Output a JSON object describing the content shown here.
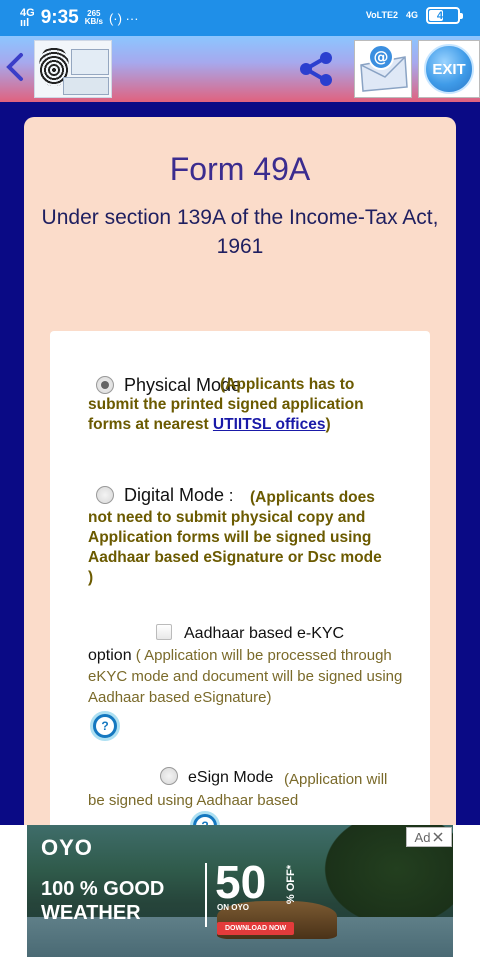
{
  "status_bar": {
    "network": "4G",
    "time": "9:35",
    "speed_value": "265",
    "speed_unit": "KB/s",
    "misc_icons": "(·) ···",
    "volte": "VoLTE2",
    "net_right": "4G",
    "battery": "44"
  },
  "app_bar": {
    "back_icon": "chevron-left-icon",
    "share_icon": "share-icon",
    "mail_icon": "email-icon",
    "exit_label": "EXIT"
  },
  "form": {
    "title": "Form 49A",
    "subtitle": "Under section 139A of the Income-Tax Act, 1961",
    "physical": {
      "label": "Physical Mode",
      "desc_before_link": "(Applicants has to submit the printed signed application forms at nearest ",
      "link_text": "UTIITSL offices",
      "desc_after_link": ")",
      "checked": true
    },
    "digital": {
      "label": "Digital Mode",
      "desc": "(Applicants does not need to submit physical copy and Application forms will be signed using Aadhaar based eSignature or Dsc mode )",
      "checked": false
    },
    "ekyc": {
      "label_first": "Aadhaar based e-KYC",
      "label_second": "option",
      "desc": "( Application will be processed through eKYC mode and document will be signed using Aadhaar based eSignature)"
    },
    "esign": {
      "label": "eSign Mode",
      "desc": "(Application will be signed using Aadhaar based"
    },
    "help_icon": "?"
  },
  "ad": {
    "brand": "OYO",
    "headline_1": "100 % GOOD",
    "headline_2": "WEATHER",
    "discount": "50",
    "off": "% OFF*",
    "on_oyo": "ON OYO",
    "cta": "DOWNLOAD NOW",
    "badge": "Ad",
    "close_icon": "close-icon"
  },
  "colors": {
    "background": "#0a0a85",
    "status_bar": "#1f8fe8",
    "card": "#fbdcca",
    "title": "#3b2c8f"
  }
}
